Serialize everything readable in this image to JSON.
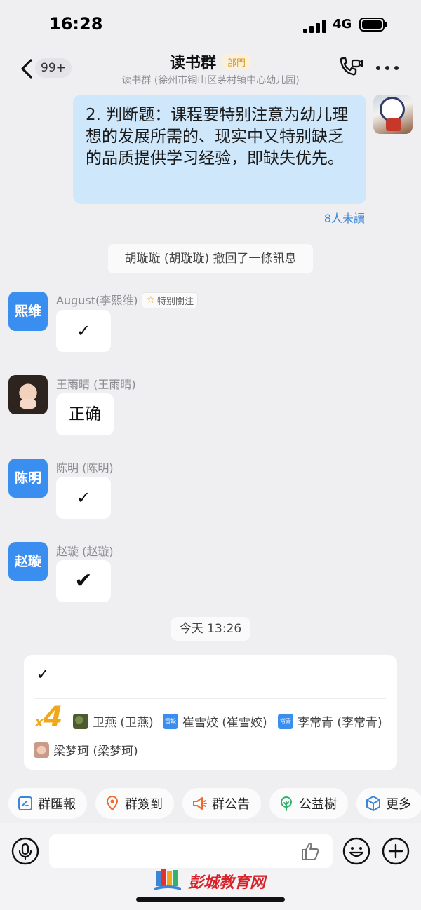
{
  "status": {
    "time": "16:28",
    "network": "4G"
  },
  "nav": {
    "badge": "99+",
    "title": "读书群",
    "tag": "部門",
    "subtitle": "读书群 (徐州市铜山区茅村镇中心幼儿园)"
  },
  "my_message": {
    "text": "2. 判断题：课程要特别注意为幼儿理想的发展所需的、现实中又特别缺乏的品质提供学习经验，即缺失优先。",
    "unread": "8人未讀"
  },
  "recall_notice": "胡璇璇 (胡璇璇) 撤回了一條訊息",
  "messages": [
    {
      "avatar_text": "熙维",
      "sender": "August(李熙维)",
      "special_tag": "特别關注",
      "text": "✓"
    },
    {
      "avatar_text": "",
      "sender": "王雨晴 (王雨晴)",
      "text": "正确"
    },
    {
      "avatar_text": "陈明",
      "sender": "陈明 (陈明)",
      "text": "✓"
    },
    {
      "avatar_text": "赵璇",
      "sender": "赵璇 (赵璇)",
      "text": "✔"
    }
  ],
  "time_divider": "今天 13:26",
  "reply_card": {
    "content": "✓",
    "count_x": "x",
    "count_n": "4",
    "people": [
      {
        "name": "卫燕 (卫燕)",
        "avatar_text": ""
      },
      {
        "name": "崔雪姣 (崔雪姣)",
        "avatar_text": "雪姣"
      },
      {
        "name": "李常青 (李常青)",
        "avatar_text": "常青"
      },
      {
        "name": "梁梦珂 (梁梦珂)",
        "avatar_text": ""
      }
    ]
  },
  "quick_actions": [
    {
      "label": "群匯報",
      "icon": "report-icon",
      "color": "#3a86d8"
    },
    {
      "label": "群簽到",
      "icon": "location-pin-icon",
      "color": "#ef6a2a"
    },
    {
      "label": "群公告",
      "icon": "megaphone-icon",
      "color": "#ef6a2a"
    },
    {
      "label": "公益樹",
      "icon": "tree-icon",
      "color": "#34b16a"
    },
    {
      "label": "更多",
      "icon": "cube-icon",
      "color": "#3a86d8"
    }
  ],
  "input": {
    "placeholder": ""
  },
  "watermark": "彭城教育网"
}
